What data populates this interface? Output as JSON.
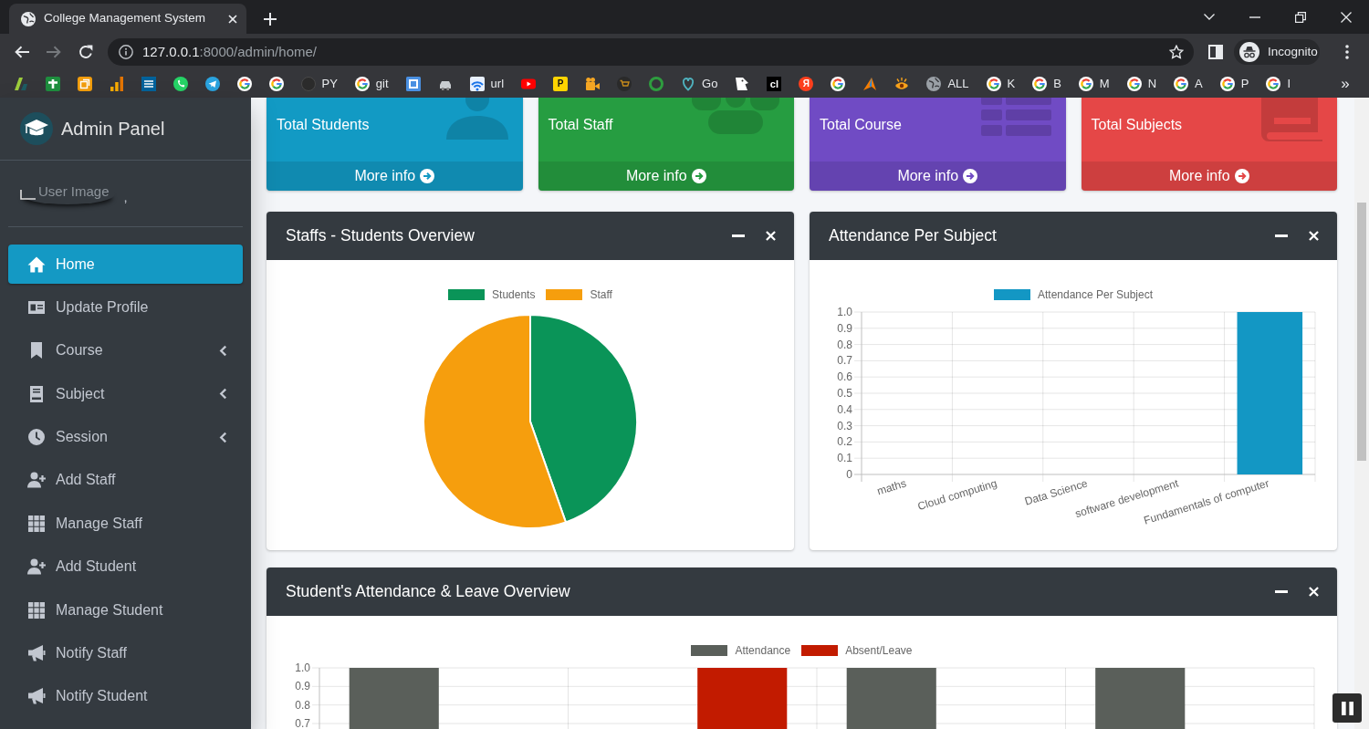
{
  "browser": {
    "tab": {
      "title": "College Management System"
    },
    "address": {
      "host": "127.0.0.1",
      "rest": ":8000/admin/home/"
    },
    "profile": {
      "label": "Incognito"
    },
    "bookmarks": [
      {
        "kind": "icon"
      },
      {
        "kind": "icon"
      },
      {
        "kind": "icon"
      },
      {
        "kind": "icon"
      },
      {
        "kind": "icon"
      },
      {
        "kind": "icon"
      },
      {
        "kind": "icon"
      },
      {
        "kind": "icon"
      },
      {
        "kind": "icon"
      },
      {
        "kind": "labeled",
        "label": "PY"
      },
      {
        "kind": "labeled",
        "label": "git"
      },
      {
        "kind": "icon"
      },
      {
        "kind": "icon"
      },
      {
        "kind": "labeled",
        "label": "url"
      },
      {
        "kind": "icon"
      },
      {
        "kind": "glyph",
        "text": "P"
      },
      {
        "kind": "icon"
      },
      {
        "kind": "icon"
      },
      {
        "kind": "icon"
      },
      {
        "kind": "labeled",
        "label": "Go"
      },
      {
        "kind": "icon"
      },
      {
        "kind": "glyph",
        "text": "cl"
      },
      {
        "kind": "glyph",
        "text": "Я"
      },
      {
        "kind": "icon"
      },
      {
        "kind": "icon"
      },
      {
        "kind": "icon"
      },
      {
        "kind": "labeled",
        "label": "ALL"
      },
      {
        "kind": "labeled",
        "label": "K"
      },
      {
        "kind": "labeled",
        "label": "B"
      },
      {
        "kind": "labeled",
        "label": "M"
      },
      {
        "kind": "labeled",
        "label": "N"
      },
      {
        "kind": "labeled",
        "label": "A"
      },
      {
        "kind": "labeled",
        "label": "P"
      },
      {
        "kind": "labeled",
        "label": "I"
      }
    ],
    "bookmarks_overflow": "»"
  },
  "sidebar": {
    "brand": "Admin Panel",
    "user": {
      "image_alt": "User Image",
      "name": ","
    },
    "items": [
      {
        "label": "Home",
        "selected": true,
        "expandable": false
      },
      {
        "label": "Update Profile",
        "selected": false,
        "expandable": false
      },
      {
        "label": "Course",
        "selected": false,
        "expandable": true
      },
      {
        "label": "Subject",
        "selected": false,
        "expandable": true
      },
      {
        "label": "Session",
        "selected": false,
        "expandable": true
      },
      {
        "label": "Add Staff",
        "selected": false,
        "expandable": false
      },
      {
        "label": "Manage Staff",
        "selected": false,
        "expandable": false
      },
      {
        "label": "Add Student",
        "selected": false,
        "expandable": false
      },
      {
        "label": "Manage Student",
        "selected": false,
        "expandable": false
      },
      {
        "label": "Notify Staff",
        "selected": false,
        "expandable": false
      },
      {
        "label": "Notify Student",
        "selected": false,
        "expandable": false
      }
    ]
  },
  "summary_boxes": [
    {
      "title": "Total Students",
      "link": "More info",
      "color": "#129ac4"
    },
    {
      "title": "Total Staff",
      "link": "More info",
      "color": "#269d41"
    },
    {
      "title": "Total Course",
      "link": "More info",
      "color": "#704bc4"
    },
    {
      "title": "Total Subjects",
      "link": "More info",
      "color": "#e54747"
    }
  ],
  "overview_card": {
    "title": "Staffs - Students Overview",
    "legend": [
      {
        "name": "Students",
        "color": "#0a9458"
      },
      {
        "name": "Staff",
        "color": "#f69e0d"
      }
    ]
  },
  "subject_attendance_card": {
    "title": "Attendance Per Subject",
    "chart_data": {
      "type": "bar",
      "categories": [
        "maths",
        "Cloud computing",
        "Data Science",
        "software development",
        "Fundamentals of computer"
      ],
      "series": [
        {
          "name": "Attendance Per Subject",
          "color": "#1397c4",
          "values": [
            0,
            0,
            0,
            0,
            1
          ]
        }
      ],
      "ylim": [
        0,
        1
      ],
      "yticks": [
        0,
        0.1,
        0.2,
        0.3,
        0.4,
        0.5,
        0.6,
        0.7,
        0.8,
        0.9,
        {
          "value": 1,
          "label": "1.0"
        }
      ],
      "grid": true,
      "legend": "top"
    }
  },
  "student_attendance_card": {
    "title": "Student's Attendance & Leave Overview",
    "chart_data": {
      "type": "bar",
      "series": [
        {
          "name": "Attendance",
          "color": "#5a5f5a",
          "values": [
            1,
            null,
            1,
            1
          ]
        },
        {
          "name": "Absent/Leave",
          "color": "#c21b00",
          "values": [
            null,
            1,
            null,
            null
          ]
        }
      ],
      "ylim": [
        0.7,
        1
      ],
      "yticks": [
        0.7,
        0.8,
        0.9,
        {
          "value": 1,
          "label": "1.0"
        }
      ],
      "grid": true,
      "legend": "top"
    }
  }
}
